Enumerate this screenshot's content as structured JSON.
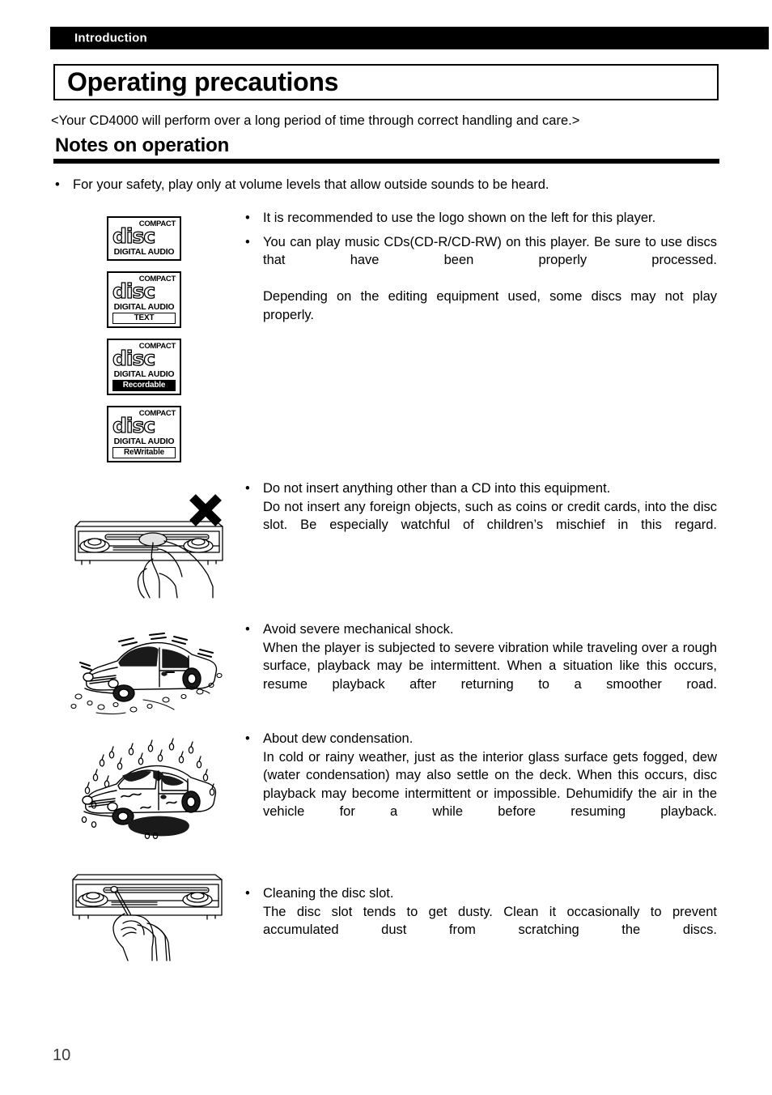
{
  "header": {
    "chapter_label": "Introduction",
    "title": "Operating precautions"
  },
  "lead_line": "<Your CD4000 will perform over a long period of time through correct handling and care.>",
  "section": {
    "heading": "Notes on operation"
  },
  "bullet_mark": "•",
  "top_note": "For your safety, play only at volume levels that allow outside sounds to be heard.",
  "cd_logos": [
    {
      "name": "cd-logo-digital-audio",
      "compact": "COMPACT",
      "disc": "disc",
      "digital_audio": "DIGITAL AUDIO",
      "badge": "",
      "badge_style": "none"
    },
    {
      "name": "cd-logo-text",
      "compact": "COMPACT",
      "disc": "disc",
      "digital_audio": "DIGITAL AUDIO",
      "badge": "TEXT",
      "badge_style": "outline"
    },
    {
      "name": "cd-logo-recordable",
      "compact": "COMPACT",
      "disc": "disc",
      "digital_audio": "DIGITAL AUDIO",
      "badge": "Recordable",
      "badge_style": "inverse"
    },
    {
      "name": "cd-logo-rewritable",
      "compact": "COMPACT",
      "disc": "disc",
      "digital_audio": "DIGITAL AUDIO",
      "badge": "ReWritable",
      "badge_style": "outline"
    }
  ],
  "notes": {
    "logo_note": {
      "bullet1": "It is recommended to use the logo shown on the left for this player.",
      "bullet2_line1": "You can play music CDs(CD-R/CD-RW) on this player. Be sure to use discs that have been properly processed.",
      "bullet2_line2": "Depending on the editing equipment used, some discs may not play properly."
    },
    "foreign_objects": {
      "heading": "Do not insert anything other than a CD into this equipment.",
      "body": "Do not insert any foreign objects, such as coins or credit cards, into the disc slot. Be especially watchful of children’s mischief in this regard."
    },
    "mechanical_shock": {
      "heading": "Avoid severe mechanical shock.",
      "body": "When the player is subjected to severe vibration while traveling over a rough surface, playback may be intermittent. When a situation like this occurs, resume playback after returning to a smoother road."
    },
    "dew_condensation": {
      "heading": "About dew condensation.",
      "body": "In cold or rainy weather, just as the interior glass surface gets fogged, dew (water condensation) may also settle on the deck. When this occurs, disc playback may become intermittent or impossible. Dehumidify the air in the vehicle for a while before resuming playback."
    },
    "cleaning": {
      "heading": "Cleaning the disc slot.",
      "body": "The disc slot tends to get dusty. Clean it occasionally to prevent accumulated dust from scratching the discs."
    }
  },
  "illustrations": {
    "coin_insert": "coin-into-disc-slot-illustration",
    "prohibition": "x-mark-icon",
    "rough_road": "car-on-rough-road-illustration",
    "rain": "car-in-rain-illustration",
    "slot_cleaning": "cleaning-disc-slot-illustration"
  },
  "page_number": "10",
  "colors": {
    "ink": "#000000",
    "paper": "#ffffff",
    "page_number": "#3a3a3a"
  }
}
